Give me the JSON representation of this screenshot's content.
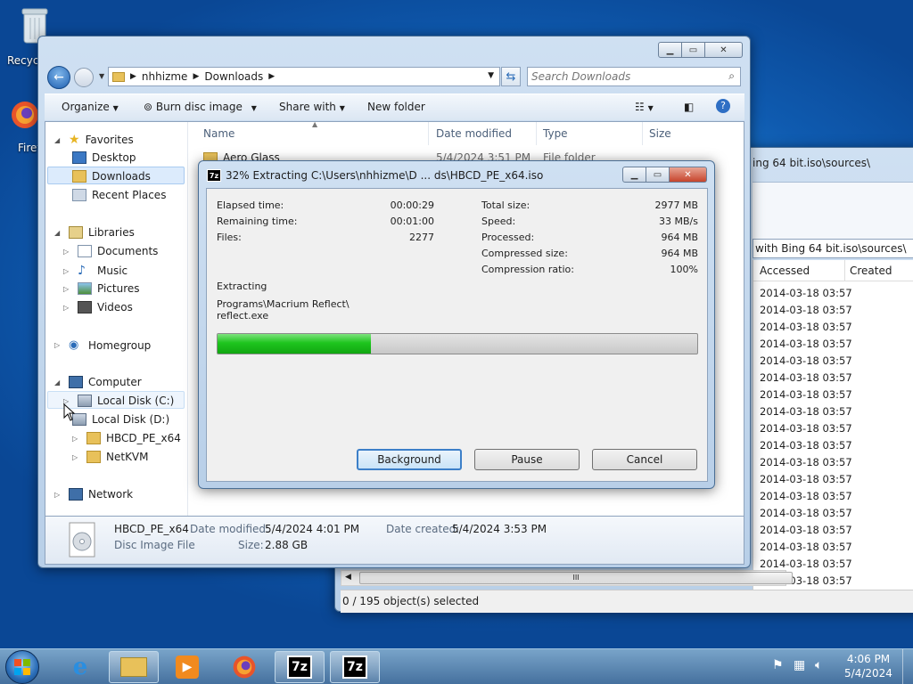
{
  "desktop": {
    "recycle_label": "Recycl",
    "firefox_label": "Firef"
  },
  "bg_window": {
    "path": "ing 64 bit.iso\\sources\\",
    "path2": "with Bing 64 bit.iso\\sources\\",
    "col_accessed": "Accessed",
    "col_created": "Created",
    "rows": [
      "2014-03-18 03:57",
      "2014-03-18 03:57",
      "2014-03-18 03:57",
      "2014-03-18 03:57",
      "2014-03-18 03:57",
      "2014-03-18 03:57",
      "2014-03-18 03:57",
      "2014-03-18 03:57",
      "2014-03-18 03:57",
      "2014-03-18 03:57",
      "2014-03-18 03:57",
      "2014-03-18 03:57",
      "2014-03-18 03:57",
      "2014-03-18 03:57",
      "2014-03-18 03:57",
      "2014-03-18 03:57",
      "2014-03-18 03:57",
      "2014-03-18 03:57"
    ],
    "status": "0 / 195 object(s) selected",
    "scroll_grip": "III"
  },
  "explorer": {
    "breadcrumb": [
      "nhhizme",
      "Downloads"
    ],
    "search_placeholder": "Search Downloads",
    "toolbar": {
      "organize": "Organize",
      "burn": "Burn disc image",
      "share": "Share with",
      "new_folder": "New folder"
    },
    "columns": {
      "name": "Name",
      "date": "Date modified",
      "type": "Type",
      "size": "Size"
    },
    "file_row": {
      "name": "Aero Glass",
      "date": "5/4/2024 3:51 PM",
      "type": "File folder"
    },
    "nav": {
      "favorites": "Favorites",
      "desktop": "Desktop",
      "downloads": "Downloads",
      "recent": "Recent Places",
      "libraries": "Libraries",
      "documents": "Documents",
      "music": "Music",
      "pictures": "Pictures",
      "videos": "Videos",
      "homegroup": "Homegroup",
      "computer": "Computer",
      "disk_c": "Local Disk (C:)",
      "disk_d": "Local Disk (D:)",
      "hbcd": "HBCD_PE_x64",
      "netkvm": "NetKVM",
      "network": "Network"
    },
    "details": {
      "name": "HBCD_PE_x64",
      "kind": "Disc Image File",
      "date_mod_label": "Date modified:",
      "date_mod": "5/4/2024 4:01 PM",
      "size_label": "Size:",
      "size": "2.88 GB",
      "date_created_label": "Date created:",
      "date_created": "5/4/2024 3:53 PM"
    }
  },
  "zip": {
    "title": "32% Extracting C:\\Users\\nhhizme\\D ... ds\\HBCD_PE_x64.iso",
    "icon": "7z",
    "elapsed_label": "Elapsed time:",
    "elapsed": "00:00:29",
    "remaining_label": "Remaining time:",
    "remaining": "00:01:00",
    "files_label": "Files:",
    "files": "2277",
    "total_label": "Total size:",
    "total": "2977 MB",
    "speed_label": "Speed:",
    "speed": "33 MB/s",
    "processed_label": "Processed:",
    "processed": "964 MB",
    "compressed_label": "Compressed size:",
    "compressed": "964 MB",
    "ratio_label": "Compression ratio:",
    "ratio": "100%",
    "extracting_label": "Extracting",
    "path_line1": "Programs\\Macrium Reflect\\",
    "path_line2": "reflect.exe",
    "progress_fraction": 0.32,
    "btn_background": "Background",
    "btn_pause": "Pause",
    "btn_cancel": "Cancel"
  },
  "taskbar": {
    "time": "4:06 PM",
    "date": "5/4/2024",
    "zip_label": "7z"
  },
  "colors": {
    "progress_green": "#1ec51e",
    "accent": "#3c7fc8"
  }
}
